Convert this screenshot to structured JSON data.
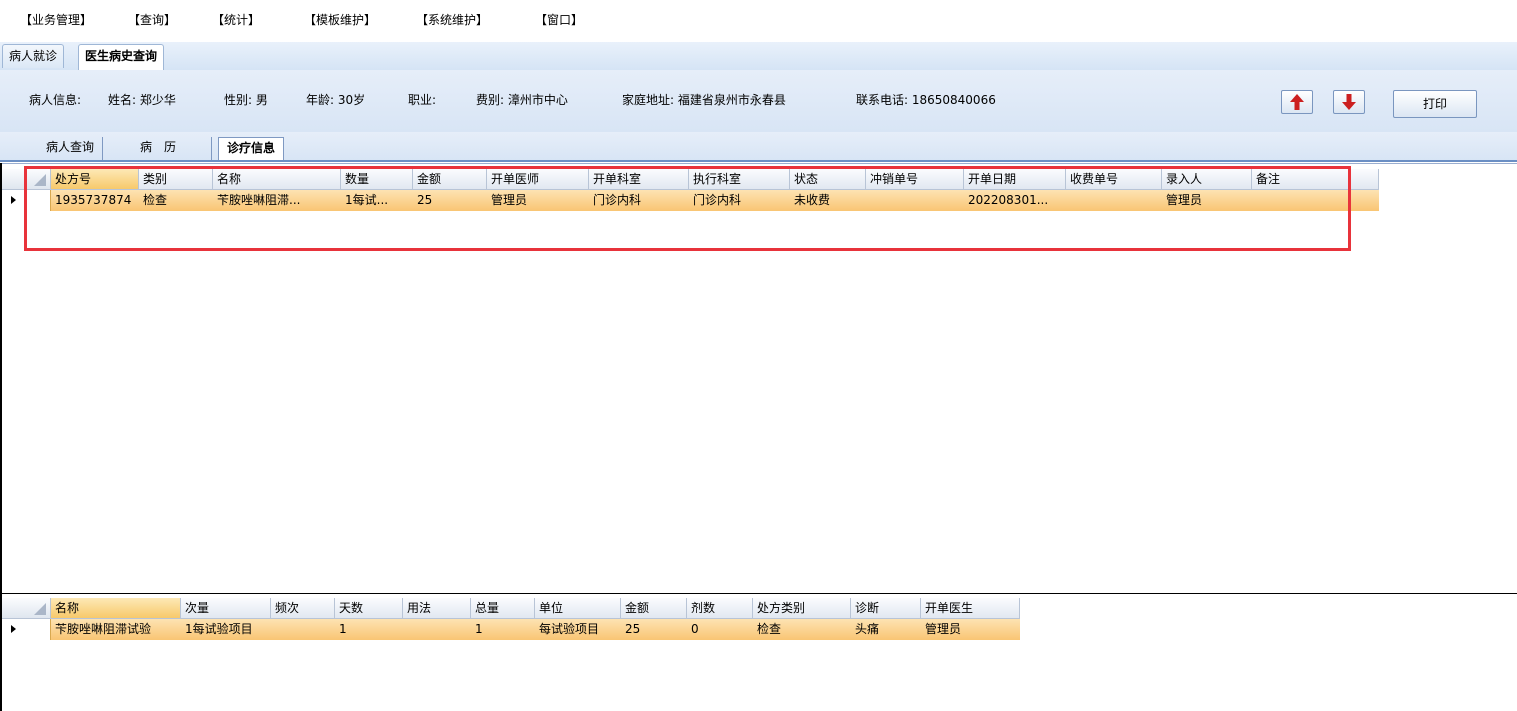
{
  "menu": [
    "【业务管理】",
    "【查询】",
    "【统计】",
    "【模板维护】",
    "【系统维护】",
    "【窗口】"
  ],
  "top_tabs": [
    {
      "label": "病人就诊",
      "active": false
    },
    {
      "label": "医生病史查询",
      "active": true
    }
  ],
  "patient_info": {
    "prefix": "病人信息:",
    "name": "姓名: 郑少华",
    "sex": "性别: 男",
    "age": "年龄: 30岁",
    "occupation": "职业:",
    "fee_type": "费别: 漳州市中心",
    "address": "家庭地址: 福建省泉州市永春县",
    "phone": "联系电话: 18650840066"
  },
  "buttons": {
    "up_icon": "arrow-up-icon",
    "down_icon": "arrow-down-icon",
    "print": "打印"
  },
  "sub_tabs": [
    {
      "label": "病人查询",
      "active": false
    },
    {
      "label": "病　历",
      "active": false
    },
    {
      "label": "诊疗信息",
      "active": true
    }
  ],
  "grid1": {
    "columns": [
      "处方号",
      "类别",
      "名称",
      "数量",
      "金额",
      "开单医师",
      "开单科室",
      "执行科室",
      "状态",
      "冲销单号",
      "开单日期",
      "收费单号",
      "录入人",
      "备注"
    ],
    "rows": [
      [
        "1935737874",
        "检查",
        "苄胺唑啉阻滞...",
        "1每试...",
        "25",
        "管理员",
        "门诊内科",
        "门诊内科",
        "未收费",
        "",
        "202208301...",
        "",
        "管理员",
        ""
      ]
    ]
  },
  "grid2": {
    "columns": [
      "名称",
      "次量",
      "频次",
      "天数",
      "用法",
      "总量",
      "单位",
      "金额",
      "剂数",
      "处方类别",
      "诊断",
      "开单医生"
    ],
    "rows": [
      [
        "苄胺唑啉阻滞试验",
        "1每试验项目",
        "",
        "1",
        "",
        "1",
        "每试验项目",
        "25",
        "0",
        "检查",
        "头痛",
        "管理员"
      ]
    ]
  },
  "colors": {
    "highlight_border": "#e8333b",
    "selected_row": "#f9c573",
    "arrow": "#cc1f1f"
  }
}
